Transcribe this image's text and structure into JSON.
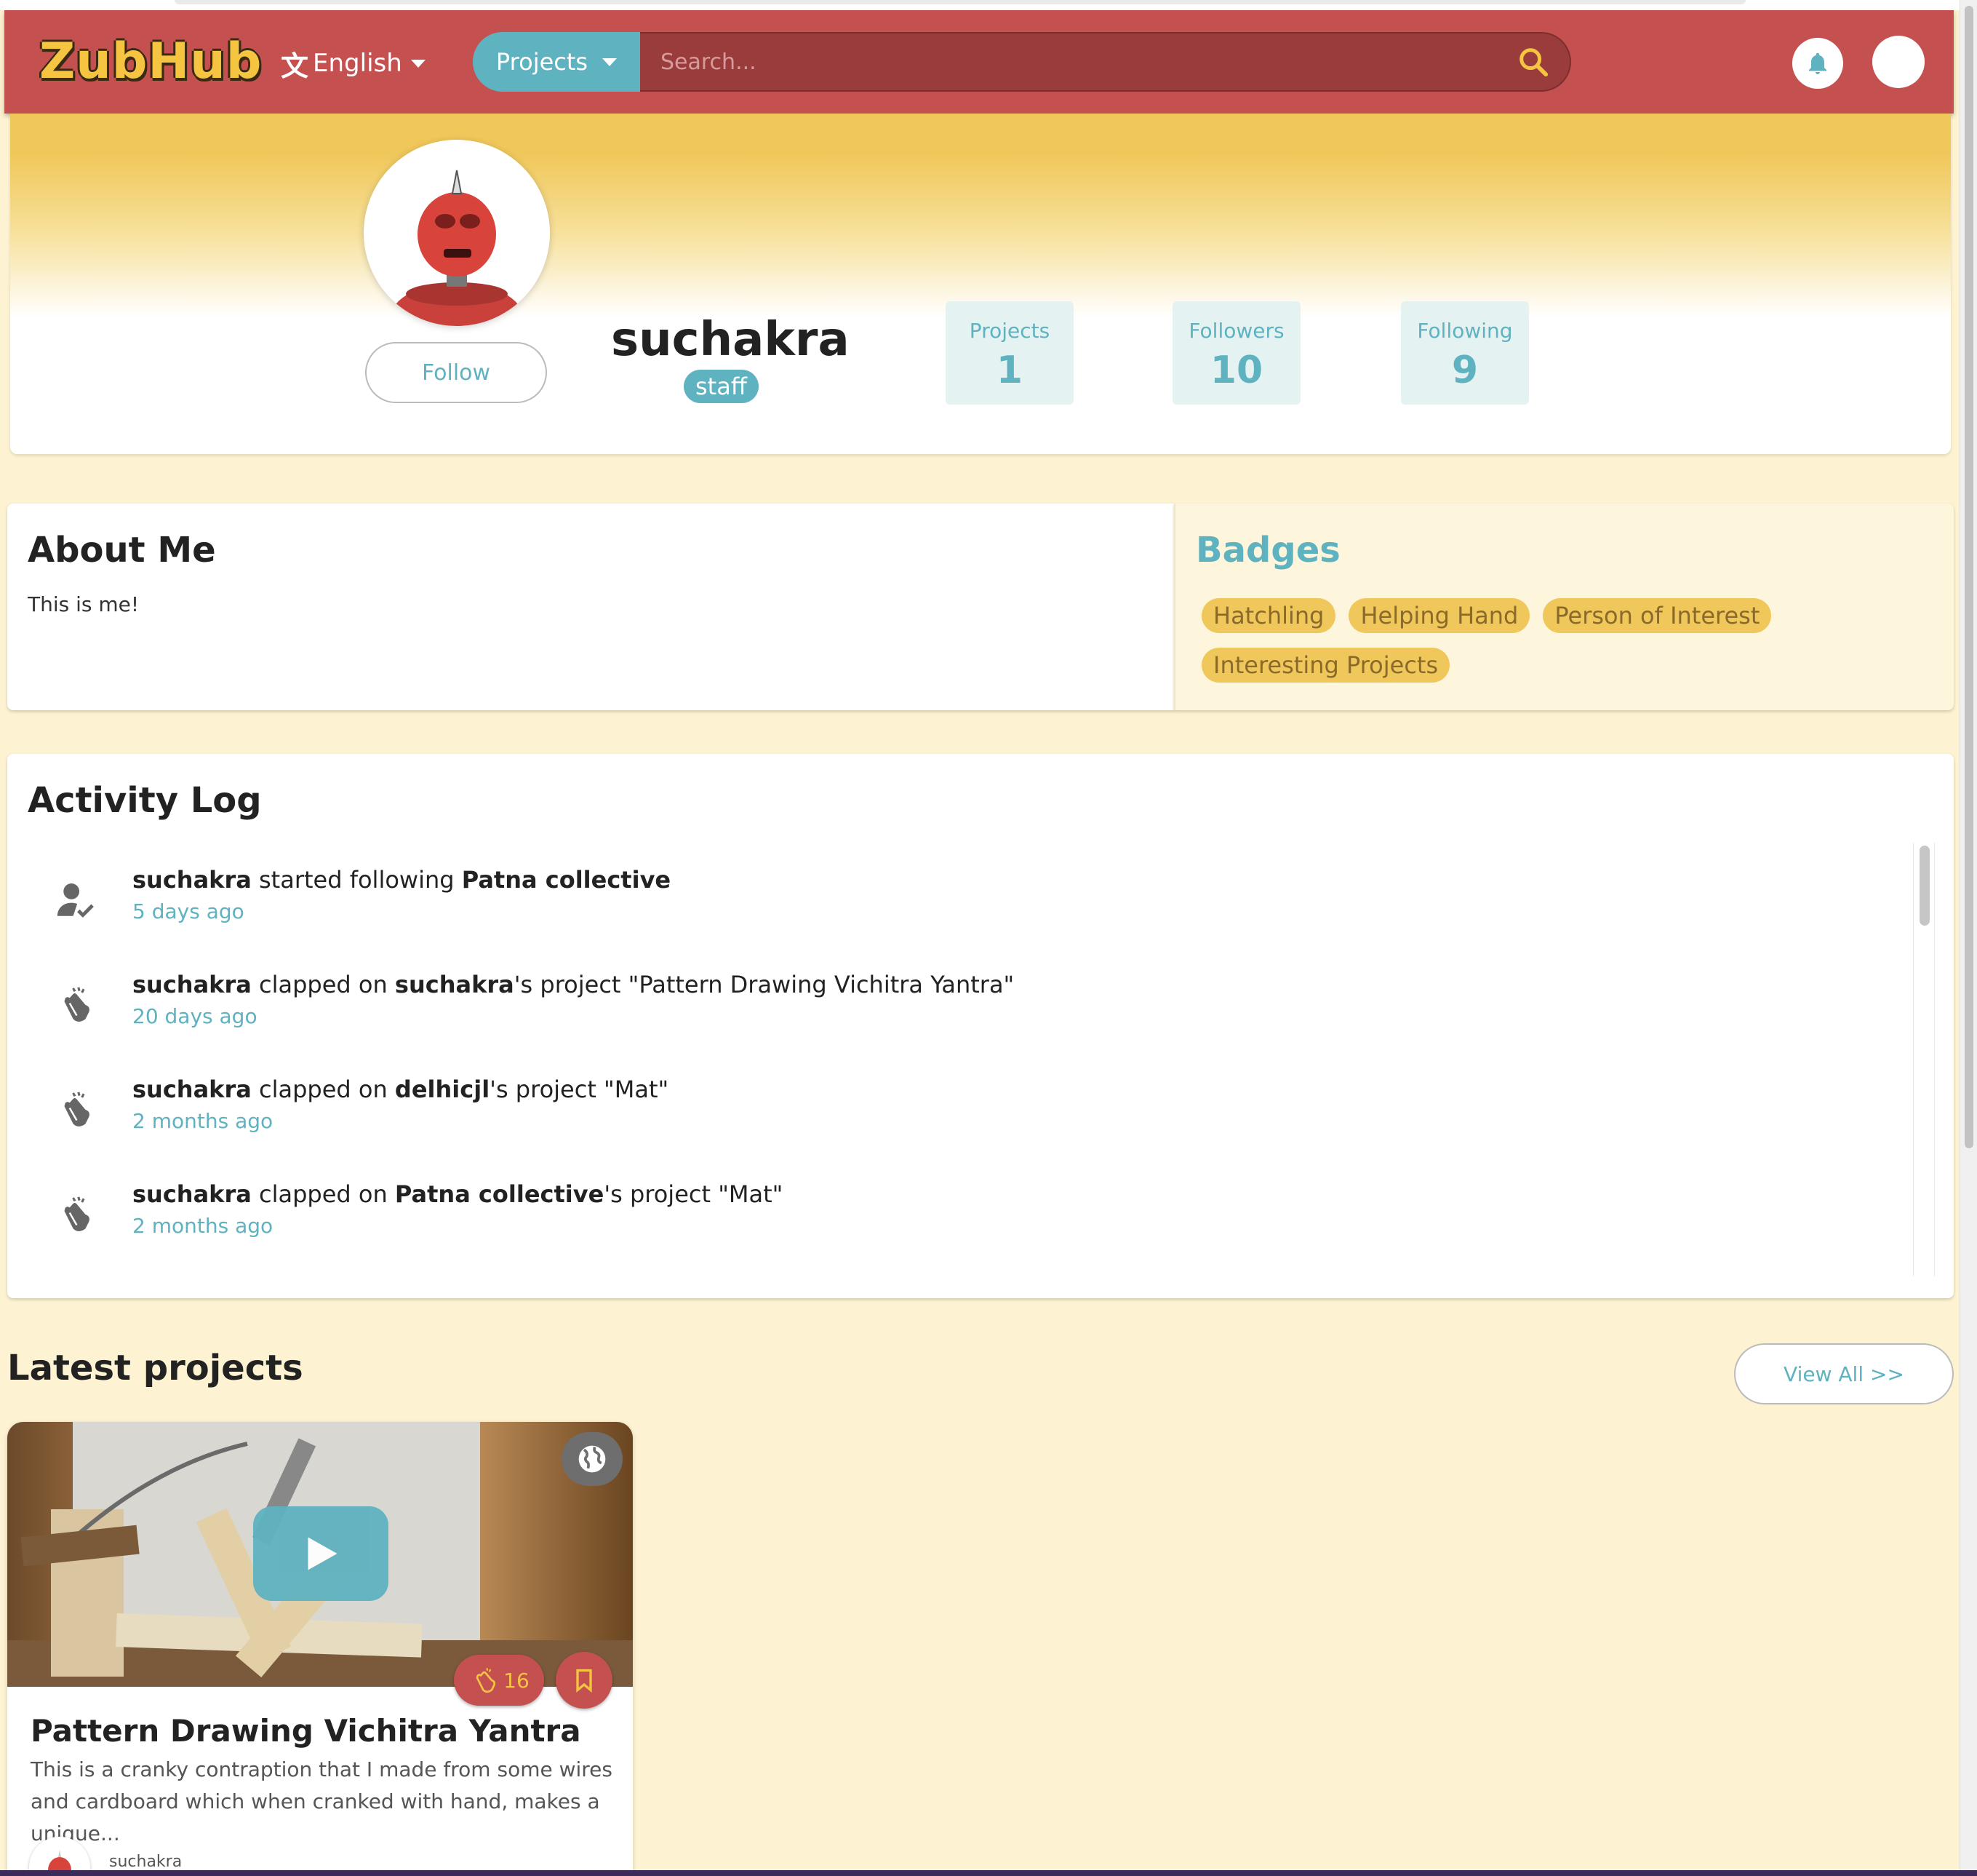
{
  "brand": {
    "logo_text": "ZubHub"
  },
  "header": {
    "language": "English",
    "search_category": "Projects",
    "search_placeholder": "Search..."
  },
  "profile": {
    "username": "suchakra",
    "role_badge": "staff",
    "follow_label": "Follow",
    "stats": [
      {
        "label": "Projects",
        "value": "1"
      },
      {
        "label": "Followers",
        "value": "10"
      },
      {
        "label": "Following",
        "value": "9"
      }
    ]
  },
  "about": {
    "title": "About Me",
    "text": "This is me!"
  },
  "badges": {
    "title": "Badges",
    "items": [
      "Hatchling",
      "Helping Hand",
      "Person of Interest",
      "Interesting Projects"
    ]
  },
  "activity": {
    "title": "Activity Log",
    "items": [
      {
        "icon": "user-check-icon",
        "actor": "suchakra",
        "verb": " started following ",
        "target": "Patna collective",
        "rest": "",
        "time": "5 days ago"
      },
      {
        "icon": "clap-icon",
        "actor": "suchakra",
        "verb": " clapped on ",
        "target": "suchakra",
        "rest": "'s project \"Pattern Drawing Vichitra Yantra\"",
        "time": "20 days ago"
      },
      {
        "icon": "clap-icon",
        "actor": "suchakra",
        "verb": " clapped on ",
        "target": "delhicjl",
        "rest": "'s project \"Mat\"",
        "time": "2 months ago"
      },
      {
        "icon": "clap-icon",
        "actor": "suchakra",
        "verb": " clapped on ",
        "target": "Patna collective",
        "rest": "'s project \"Mat\"",
        "time": "2 months ago"
      }
    ]
  },
  "latest": {
    "title": "Latest projects",
    "view_all": "View All >>",
    "project": {
      "title": "Pattern Drawing Vichitra Yantra",
      "description": "This is a cranky contraption that I made from some wires and cardboard which when cranked with hand, makes a unique...",
      "claps": "16",
      "author": "suchakra"
    }
  },
  "colors": {
    "navbar": "#c55050",
    "accent": "#5fb2c0",
    "badge": "#f0c75b",
    "page_bg": "#fdf3d2"
  }
}
